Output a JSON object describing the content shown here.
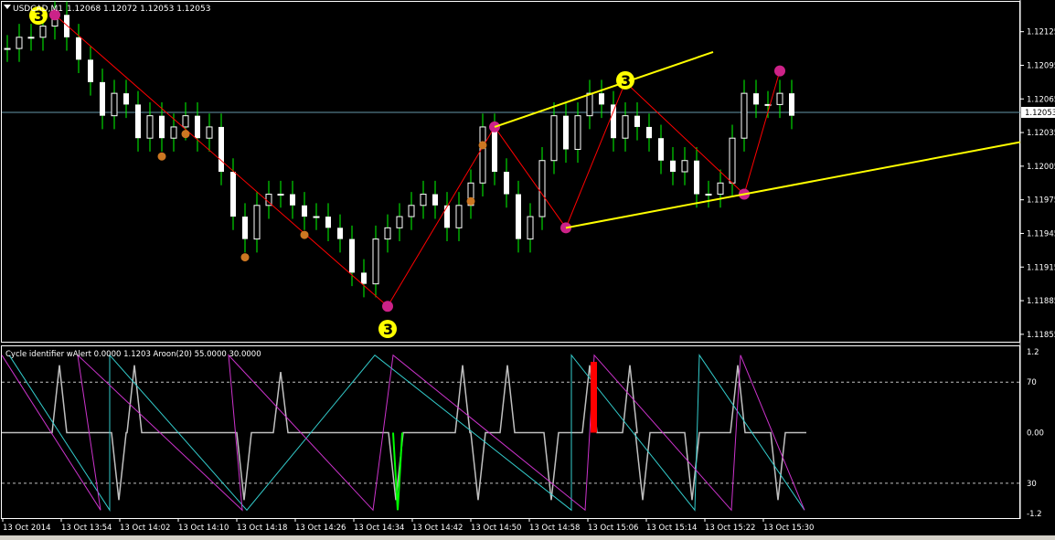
{
  "header": {
    "symbol": "USDCAD,M1",
    "ohlc": "1.12068 1.12072 1.12053 1.12053"
  },
  "indicator_header": "Cycle identifier wAlert 0.0000 1.1203  Aroon(20) 55.0000 30.0000",
  "colors": {
    "background": "#000000",
    "bull_candle": "#ffffff",
    "bear_candle": "#ffffff",
    "candle_wick": "#00ff00",
    "zigzag": "#ff0000",
    "trendline": "#ffff00",
    "fractal_magenta": "#cc2288",
    "fractal_orange": "#cc7722",
    "cycle_line": "#c0c0c0",
    "aroon_up": "#33cccc",
    "aroon_down": "#cc33cc",
    "buy_signal": "#00ff00",
    "sell_signal": "#ff0000",
    "current_price_line": "#6699aa"
  },
  "chart_data": [
    {
      "type": "candlestick",
      "title": "USDCAD,M1",
      "price_axis": [
        "1.12125",
        "1.12095",
        "1.12065",
        "1.12035",
        "1.12005",
        "1.11975",
        "1.11945",
        "1.11915",
        "1.11885",
        "1.11855"
      ],
      "ylim": [
        1.1185,
        1.1215
      ],
      "current_price": "1.12053",
      "time_axis": [
        "13 Oct 2014",
        "13 Oct 13:54",
        "13 Oct 14:02",
        "13 Oct 14:10",
        "13 Oct 14:18",
        "13 Oct 14:26",
        "13 Oct 14:34",
        "13 Oct 14:42",
        "13 Oct 14:50",
        "13 Oct 14:58",
        "13 Oct 15:06",
        "13 Oct 15:14",
        "13 Oct 15:22",
        "13 Oct 15:30"
      ],
      "closes": [
        1.1211,
        1.1212,
        1.1212,
        1.1213,
        1.1214,
        1.1212,
        1.121,
        1.1208,
        1.1205,
        1.1207,
        1.1206,
        1.1203,
        1.1205,
        1.1203,
        1.1204,
        1.1205,
        1.1203,
        1.1204,
        1.12,
        1.1196,
        1.1194,
        1.1197,
        1.1198,
        1.1198,
        1.1197,
        1.1196,
        1.1196,
        1.1195,
        1.1194,
        1.1191,
        1.119,
        1.1194,
        1.1195,
        1.1196,
        1.1197,
        1.1198,
        1.1197,
        1.1195,
        1.1197,
        1.1199,
        1.1204,
        1.12,
        1.1198,
        1.1194,
        1.1196,
        1.1201,
        1.1205,
        1.1202,
        1.1205,
        1.1207,
        1.1206,
        1.1203,
        1.1205,
        1.1204,
        1.1203,
        1.1201,
        1.12,
        1.1201,
        1.1198,
        1.1198,
        1.1199,
        1.1203,
        1.1207,
        1.1206,
        1.1206,
        1.1207,
        1.1205
      ],
      "zigzag": [
        [
          4,
          1.1214
        ],
        [
          32,
          1.1188
        ],
        [
          41,
          1.1204
        ],
        [
          47,
          1.1195
        ],
        [
          52,
          1.1208
        ],
        [
          62,
          1.1198
        ],
        [
          65,
          1.1209
        ]
      ],
      "cycle_marks": [
        {
          "label": "3",
          "bar": 3
        },
        {
          "label": "3",
          "bar": 32
        },
        {
          "label": "3",
          "bar": 52
        }
      ]
    },
    {
      "type": "line",
      "title": "Cycle identifier wAlert / Aroon(20)",
      "series": [
        {
          "name": "Cycle identifier",
          "values": [
            0
          ]
        },
        {
          "name": "Aroon Up",
          "values": [
            55
          ]
        },
        {
          "name": "Aroon Down",
          "values": [
            30
          ]
        }
      ],
      "axis": [
        "1.2",
        "70",
        "0.00",
        "30",
        "-1.2"
      ]
    }
  ]
}
